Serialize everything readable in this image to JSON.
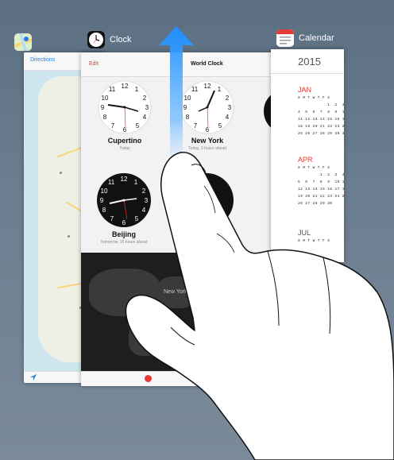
{
  "switcher": {
    "clock_label": "Clock",
    "calendar_label": "Calendar",
    "maps_icon": "maps-icon",
    "clock_icon": "clock-icon",
    "calendar_icon": "calendar-icon"
  },
  "maps": {
    "header_label": "Directions",
    "footer_icon": "location-arrow-icon"
  },
  "clock": {
    "edit_label": "Edit",
    "title": "World Clock",
    "cities": [
      {
        "name": "Cupertino",
        "sub": "Today"
      },
      {
        "name": "New York",
        "sub": "Today, 3 hours ahead"
      },
      {
        "name": "Beijing",
        "sub": "Tomorrow, 15 hours ahead"
      }
    ],
    "map_city": "New York"
  },
  "calendar": {
    "year": "2015",
    "months": [
      {
        "name": "JAN",
        "weekdays": "S M T W T F S",
        "rows": [
          "            1  2  3",
          "4  5  6  7  8  9  10",
          "11 12 13 14 15 16 17",
          "18 19 20 21 22 23 24",
          "25 26 27 28 29 30 31"
        ]
      },
      {
        "name": "APR",
        "weekdays": "S M T W T F S",
        "rows": [
          "         1  2  3  4",
          "5  6  7  8  9  10 11",
          "12 13 14 15 16 17 18",
          "19 20 21 22 23 24 25",
          "26 27 28 29 30"
        ]
      },
      {
        "name": "JUL",
        "weekdays": "S M T W T F S",
        "rows": []
      }
    ]
  },
  "colors": {
    "accent_blue": "#1e8fff",
    "calendar_red": "#e53935",
    "device_bg": "#6b7e90"
  }
}
